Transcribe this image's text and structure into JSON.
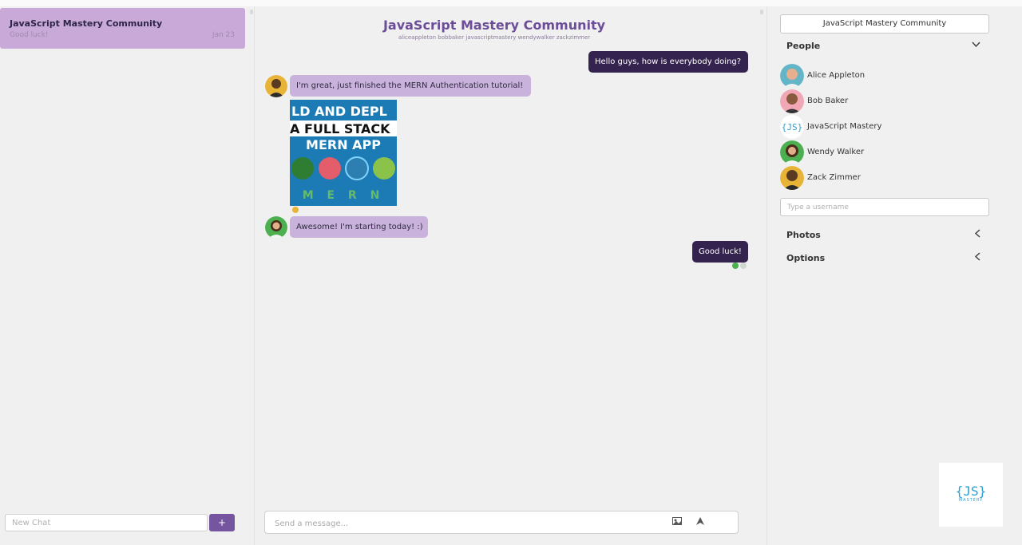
{
  "left_panel": {
    "chat": {
      "title": "JavaScript Mastery Community",
      "last_message": "Good luck!",
      "date": "Jan 23"
    },
    "new_chat_placeholder": "New Chat",
    "plus_label": "+"
  },
  "thread": {
    "title": "JavaScript Mastery Community",
    "members": "aliceappleton bobbaker javascriptmastery wendywalker zackzimmer",
    "messages": [
      {
        "text": "Hello guys, how is everybody doing?",
        "mine": true
      },
      {
        "text": "I'm great, just finished the MERN Authentication tutorial!",
        "mine": false
      },
      {
        "image_lines": [
          "LD AND DEPL",
          "A FULL STACK",
          "MERN APP"
        ],
        "image_footer": "M E R N"
      },
      {
        "text": "Awesome! I'm starting today! :)",
        "mine": false
      },
      {
        "text": "Good luck!",
        "mine": true
      }
    ],
    "composer_placeholder": "Send a message..."
  },
  "settings": {
    "title": "JavaScript Mastery Community",
    "people_label": "People",
    "people": [
      "Alice Appleton",
      "Bob Baker",
      "JavaScript Mastery",
      "Wendy Walker",
      "Zack Zimmer"
    ],
    "username_placeholder": "Type a username",
    "photos_label": "Photos",
    "options_label": "Options"
  },
  "logo": {
    "mark": "{JS}",
    "sub": "MASTERY"
  },
  "colors": {
    "accent": "#7554a0",
    "my_bubble": "#34234f",
    "their_bubble": "#c9b3dd",
    "selected_chat": "#c8a9d8"
  }
}
